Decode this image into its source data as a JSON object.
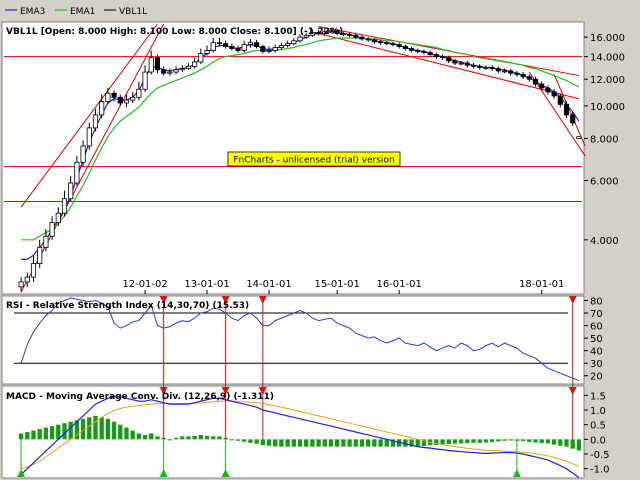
{
  "legend": [
    {
      "name": "EMA3",
      "color": "#0000ff"
    },
    {
      "name": "EMA1",
      "color": "#00b000"
    },
    {
      "name": "VBL1L",
      "color": "#000000"
    }
  ],
  "watermark": "FnCharts - unlicensed (trial) version",
  "colors": {
    "ema3": "#1f1fe0",
    "ema1": "#2cb82c",
    "trend": "#e00000",
    "rsi": "#2a3ad8",
    "macd_line": "#1f1fe0",
    "macd_signal": "#e8a020",
    "macd_hist": "#189a18",
    "signal_up": "#20b020",
    "signal_down": "#e01010"
  },
  "chart_data": [
    {
      "type": "candlestick",
      "title": "VBL1L [Open: 8.000  High: 8.100  Low: 8.000  Close: 8.100] (-1.22%)",
      "scale": "log",
      "ylim": [
        2.8,
        17.5
      ],
      "yticks": [
        "16.000",
        "14.000",
        "12.000",
        "10.000",
        "8.000",
        "6.000",
        "4.000"
      ],
      "ytick_values": [
        16,
        14,
        12,
        10,
        8,
        6,
        4
      ],
      "xticks": [
        "12-01-02",
        "13-01-01",
        "14-01-01",
        "15-01-01",
        "16-01-01",
        "18-01-01"
      ],
      "xtick_index": [
        20,
        30,
        40,
        51,
        61,
        84
      ],
      "horizontal_levels": [
        14.0,
        6.6,
        5.2
      ],
      "close": [
        3.0,
        3.1,
        3.4,
        3.8,
        4.1,
        4.5,
        4.8,
        5.3,
        5.9,
        6.8,
        7.6,
        8.6,
        9.4,
        10.3,
        10.9,
        10.6,
        10.2,
        10.4,
        10.6,
        11.2,
        12.6,
        13.9,
        12.8,
        12.5,
        12.6,
        12.8,
        12.9,
        13.1,
        13.5,
        14.3,
        14.6,
        15.4,
        15.3,
        15.0,
        14.8,
        14.6,
        15.2,
        15.4,
        15.0,
        14.5,
        14.6,
        14.9,
        15.1,
        15.3,
        15.6,
        16.0,
        16.2,
        16.5,
        16.4,
        16.6,
        16.7,
        16.4,
        16.3,
        16.2,
        16.0,
        15.8,
        15.7,
        15.5,
        15.4,
        15.3,
        15.2,
        15.0,
        14.8,
        14.6,
        14.5,
        14.4,
        14.2,
        14.0,
        13.9,
        13.6,
        13.4,
        13.4,
        13.2,
        13.1,
        13.0,
        13.0,
        12.9,
        12.7,
        12.7,
        12.5,
        12.4,
        12.2,
        12.0,
        11.6,
        11.3,
        11.0,
        10.7,
        10.1,
        9.4,
        8.9,
        8.1
      ],
      "open": [
        2.9,
        3.0,
        3.1,
        3.4,
        3.8,
        4.1,
        4.5,
        4.8,
        5.3,
        5.9,
        6.8,
        7.6,
        8.6,
        9.4,
        10.3,
        10.9,
        10.6,
        10.2,
        10.4,
        10.6,
        11.2,
        12.6,
        13.9,
        12.8,
        12.5,
        12.6,
        12.8,
        12.9,
        13.1,
        13.5,
        14.3,
        14.6,
        15.4,
        15.3,
        15.0,
        14.8,
        14.6,
        15.2,
        15.4,
        15.0,
        14.5,
        14.6,
        14.9,
        15.1,
        15.3,
        15.6,
        16.0,
        16.2,
        16.5,
        16.4,
        16.6,
        16.7,
        16.4,
        16.3,
        16.2,
        16.0,
        15.8,
        15.7,
        15.5,
        15.4,
        15.3,
        15.2,
        15.0,
        14.8,
        14.6,
        14.5,
        14.4,
        14.2,
        14.0,
        13.9,
        13.6,
        13.4,
        13.4,
        13.2,
        13.1,
        13.0,
        13.0,
        12.9,
        12.7,
        12.7,
        12.5,
        12.4,
        12.2,
        12.0,
        11.6,
        11.3,
        11.0,
        10.7,
        10.1,
        9.4,
        8.0
      ],
      "high": [
        3.1,
        3.2,
        3.6,
        4.0,
        4.3,
        4.7,
        5.0,
        5.6,
        6.2,
        7.1,
        7.9,
        8.9,
        9.8,
        10.8,
        11.3,
        11.1,
        10.8,
        10.8,
        11.0,
        11.8,
        13.2,
        14.6,
        14.2,
        13.1,
        12.9,
        13.1,
        13.2,
        13.4,
        13.9,
        14.8,
        15.1,
        15.9,
        15.9,
        15.6,
        15.3,
        15.1,
        15.6,
        15.8,
        15.7,
        15.2,
        15.0,
        15.2,
        15.4,
        15.6,
        15.9,
        16.3,
        16.5,
        16.9,
        16.8,
        16.9,
        17.0,
        16.9,
        16.6,
        16.5,
        16.4,
        16.2,
        16.0,
        15.9,
        15.7,
        15.6,
        15.5,
        15.4,
        15.2,
        15.0,
        14.8,
        14.7,
        14.6,
        14.4,
        14.2,
        14.1,
        13.8,
        13.6,
        13.6,
        13.4,
        13.3,
        13.2,
        13.2,
        13.1,
        12.9,
        12.9,
        12.7,
        12.6,
        12.4,
        12.2,
        11.8,
        11.5,
        11.2,
        10.9,
        10.3,
        9.6,
        8.1
      ],
      "low": [
        2.8,
        2.9,
        3.0,
        3.3,
        3.7,
        4.0,
        4.4,
        4.7,
        5.2,
        5.8,
        6.6,
        7.4,
        8.4,
        9.2,
        10.1,
        10.3,
        10.0,
        9.9,
        10.2,
        10.4,
        11.0,
        12.4,
        12.5,
        12.3,
        12.3,
        12.4,
        12.6,
        12.8,
        12.9,
        13.3,
        14.1,
        14.4,
        15.0,
        14.8,
        14.6,
        14.4,
        14.4,
        14.9,
        14.8,
        14.3,
        14.3,
        14.4,
        14.7,
        14.9,
        15.1,
        15.4,
        15.8,
        16.0,
        16.2,
        16.2,
        16.4,
        16.2,
        16.1,
        16.0,
        15.8,
        15.6,
        15.5,
        15.3,
        15.2,
        15.1,
        15.0,
        14.8,
        14.6,
        14.4,
        14.3,
        14.2,
        14.0,
        13.8,
        13.7,
        13.4,
        13.2,
        13.2,
        13.0,
        12.9,
        12.8,
        12.8,
        12.7,
        12.5,
        12.5,
        12.3,
        12.2,
        12.0,
        11.8,
        11.4,
        11.1,
        10.8,
        10.5,
        9.9,
        9.2,
        8.7,
        8.0
      ],
      "series": [
        {
          "name": "EMA3",
          "values": [
            3.5,
            3.5,
            3.6,
            3.8,
            4.0,
            4.3,
            4.6,
            4.9,
            5.4,
            6.1,
            6.9,
            7.8,
            8.6,
            9.4,
            10.2,
            10.5,
            10.4,
            10.4,
            10.6,
            11.1,
            12.1,
            13.1,
            13.0,
            12.8,
            12.7,
            12.8,
            12.9,
            13.0,
            13.3,
            13.9,
            14.3,
            14.9,
            15.1,
            15.1,
            14.9,
            14.8,
            15.0,
            15.2,
            15.1,
            14.8,
            14.7,
            14.8,
            15.0,
            15.2,
            15.4,
            15.7,
            16.0,
            16.3,
            16.4,
            16.5,
            16.6,
            16.5,
            16.4,
            16.3,
            16.1,
            15.9,
            15.8,
            15.6,
            15.5,
            15.4,
            15.3,
            15.1,
            14.9,
            14.7,
            14.6,
            14.5,
            14.3,
            14.1,
            14.0,
            13.8,
            13.6,
            13.5,
            13.3,
            13.2,
            13.1,
            13.0,
            13.0,
            12.8,
            12.8,
            12.6,
            12.5,
            12.3,
            12.1,
            11.8,
            11.5,
            11.3,
            11.0,
            10.6,
            10.1,
            9.6,
            9.0
          ]
        },
        {
          "name": "EMA1",
          "values": [
            4.0,
            4.0,
            4.0,
            4.1,
            4.2,
            4.3,
            4.5,
            4.7,
            5.0,
            5.4,
            5.8,
            6.3,
            6.9,
            7.5,
            8.1,
            8.6,
            9.0,
            9.3,
            9.6,
            9.9,
            10.4,
            10.9,
            11.3,
            11.5,
            11.7,
            11.9,
            12.1,
            12.3,
            12.5,
            12.8,
            13.1,
            13.5,
            13.8,
            14.0,
            14.1,
            14.2,
            14.3,
            14.5,
            14.6,
            14.6,
            14.6,
            14.6,
            14.7,
            14.8,
            14.9,
            15.1,
            15.2,
            15.4,
            15.6,
            15.7,
            15.8,
            15.9,
            15.9,
            15.9,
            15.9,
            15.9,
            15.8,
            15.8,
            15.7,
            15.6,
            15.6,
            15.5,
            15.4,
            15.3,
            15.2,
            15.1,
            15.0,
            14.9,
            14.7,
            14.6,
            14.4,
            14.3,
            14.2,
            14.0,
            13.9,
            13.8,
            13.7,
            13.6,
            13.5,
            13.4,
            13.3,
            13.2,
            13.0,
            12.9,
            12.7,
            12.5,
            12.3,
            12.1,
            11.9,
            11.6,
            11.4
          ]
        }
      ],
      "trendlines": [
        {
          "from": [
            0,
            2.8
          ],
          "to": [
            23,
            17.5
          ]
        },
        {
          "from": [
            0,
            5.0
          ],
          "to": [
            22,
            17.5
          ]
        },
        {
          "from": [
            48,
            17.2
          ],
          "to": [
            90,
            12.3
          ]
        },
        {
          "from": [
            48,
            16.4
          ],
          "to": [
            90,
            10.5
          ]
        },
        {
          "from": [
            82,
            12.6
          ],
          "to": [
            91,
            7.1
          ]
        },
        {
          "from": [
            86,
            12.4
          ],
          "to": [
            91,
            7.6
          ]
        }
      ]
    },
    {
      "type": "line",
      "title": "RSI - Relative Strength Index (14,30,70) (15.53)",
      "ylim": [
        15,
        82
      ],
      "yticks": [
        "80",
        "70",
        "60",
        "50",
        "40",
        "30",
        "20"
      ],
      "ytick_values": [
        80,
        70,
        60,
        50,
        40,
        30,
        20
      ],
      "horizontal_levels": [
        70,
        30
      ],
      "series": [
        {
          "name": "RSI",
          "values": [
            30,
            45,
            55,
            62,
            68,
            72,
            78,
            80,
            82,
            81,
            80,
            79,
            80,
            78,
            75,
            62,
            58,
            60,
            63,
            64,
            70,
            76,
            60,
            58,
            59,
            62,
            64,
            63,
            66,
            70,
            71,
            74,
            73,
            70,
            66,
            64,
            68,
            70,
            66,
            60,
            60,
            64,
            66,
            68,
            70,
            72,
            70,
            66,
            64,
            65,
            66,
            62,
            60,
            58,
            54,
            52,
            50,
            51,
            48,
            46,
            48,
            50,
            46,
            45,
            44,
            46,
            43,
            40,
            42,
            44,
            42,
            46,
            44,
            40,
            41,
            44,
            46,
            43,
            46,
            44,
            42,
            38,
            36,
            34,
            30,
            26,
            24,
            22,
            20,
            18,
            16
          ]
        }
      ]
    },
    {
      "type": "bar+line",
      "title": "MACD - Moving Average Conv. Div. (12,26,9) (-1.311)",
      "ylim": [
        -1.25,
        1.75
      ],
      "yticks": [
        "1.5",
        "1.0",
        "0.5",
        "0.0",
        "-0.5",
        "-1.0"
      ],
      "ytick_values": [
        1.5,
        1.0,
        0.5,
        0.0,
        -0.5,
        -1.0
      ],
      "series": [
        {
          "name": "MACD",
          "values": [
            -1.2,
            -1.0,
            -0.8,
            -0.6,
            -0.4,
            -0.2,
            0.0,
            0.2,
            0.4,
            0.6,
            0.8,
            1.0,
            1.2,
            1.3,
            1.4,
            1.45,
            1.45,
            1.4,
            1.35,
            1.3,
            1.3,
            1.35,
            1.3,
            1.25,
            1.2,
            1.2,
            1.2,
            1.2,
            1.25,
            1.3,
            1.35,
            1.4,
            1.4,
            1.35,
            1.3,
            1.25,
            1.2,
            1.15,
            1.1,
            1.0,
            0.95,
            0.9,
            0.85,
            0.8,
            0.75,
            0.7,
            0.65,
            0.6,
            0.55,
            0.5,
            0.45,
            0.4,
            0.35,
            0.3,
            0.25,
            0.2,
            0.15,
            0.1,
            0.05,
            0.0,
            -0.05,
            -0.1,
            -0.15,
            -0.2,
            -0.25,
            -0.28,
            -0.3,
            -0.33,
            -0.35,
            -0.38,
            -0.4,
            -0.42,
            -0.44,
            -0.45,
            -0.47,
            -0.48,
            -0.47,
            -0.46,
            -0.45,
            -0.45,
            -0.47,
            -0.5,
            -0.55,
            -0.6,
            -0.65,
            -0.7,
            -0.8,
            -0.9,
            -1.0,
            -1.15,
            -1.3
          ]
        },
        {
          "name": "Signal",
          "values": [
            -1.0,
            -0.95,
            -0.85,
            -0.75,
            -0.6,
            -0.45,
            -0.3,
            -0.15,
            0.0,
            0.15,
            0.3,
            0.45,
            0.6,
            0.75,
            0.88,
            0.98,
            1.05,
            1.1,
            1.12,
            1.15,
            1.18,
            1.2,
            1.22,
            1.22,
            1.22,
            1.22,
            1.22,
            1.22,
            1.23,
            1.24,
            1.26,
            1.28,
            1.3,
            1.31,
            1.3,
            1.3,
            1.28,
            1.27,
            1.25,
            1.22,
            1.18,
            1.14,
            1.1,
            1.05,
            1.0,
            0.95,
            0.9,
            0.85,
            0.8,
            0.75,
            0.7,
            0.65,
            0.6,
            0.55,
            0.5,
            0.45,
            0.4,
            0.35,
            0.3,
            0.25,
            0.2,
            0.15,
            0.1,
            0.05,
            0.0,
            -0.05,
            -0.1,
            -0.14,
            -0.18,
            -0.22,
            -0.25,
            -0.28,
            -0.31,
            -0.33,
            -0.35,
            -0.37,
            -0.38,
            -0.39,
            -0.4,
            -0.41,
            -0.42,
            -0.44,
            -0.46,
            -0.49,
            -0.52,
            -0.56,
            -0.62,
            -0.68,
            -0.75,
            -0.83,
            -0.92
          ]
        },
        {
          "name": "Histogram",
          "values": [
            0.2,
            0.25,
            0.3,
            0.35,
            0.4,
            0.45,
            0.5,
            0.55,
            0.6,
            0.65,
            0.7,
            0.75,
            0.8,
            0.75,
            0.7,
            0.6,
            0.5,
            0.4,
            0.3,
            0.2,
            0.15,
            0.2,
            0.1,
            0.05,
            0.0,
            0.05,
            0.1,
            0.1,
            0.12,
            0.15,
            0.12,
            0.1,
            0.1,
            0.05,
            0.0,
            -0.05,
            -0.08,
            -0.12,
            -0.15,
            -0.2,
            -0.22,
            -0.24,
            -0.25,
            -0.25,
            -0.25,
            -0.25,
            -0.25,
            -0.25,
            -0.25,
            -0.25,
            -0.25,
            -0.25,
            -0.25,
            -0.25,
            -0.25,
            -0.25,
            -0.25,
            -0.25,
            -0.25,
            -0.25,
            -0.25,
            -0.25,
            -0.25,
            -0.25,
            -0.25,
            -0.23,
            -0.2,
            -0.19,
            -0.17,
            -0.16,
            -0.15,
            -0.14,
            -0.13,
            -0.12,
            -0.12,
            -0.11,
            -0.09,
            -0.07,
            -0.05,
            -0.04,
            -0.05,
            -0.06,
            -0.09,
            -0.11,
            -0.13,
            -0.14,
            -0.18,
            -0.22,
            -0.25,
            -0.32,
            -0.38
          ]
        }
      ],
      "signals_down": [
        23,
        33,
        39,
        89
      ],
      "signals_up": [
        0,
        23,
        33,
        80
      ]
    }
  ]
}
